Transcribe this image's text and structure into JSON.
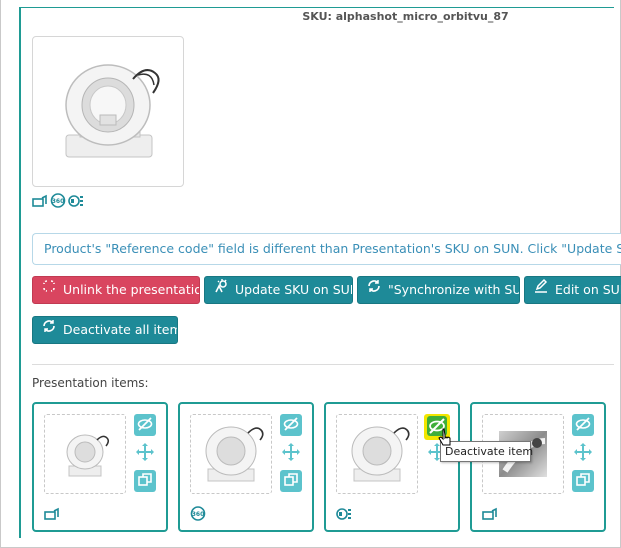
{
  "header": {
    "sku": "SKU: alphashot_micro_orbitvu_87"
  },
  "main_image": {
    "alt": "product-orbitvu-device"
  },
  "main_type_icons": [
    "photo-type-icon",
    "spin-360-icon",
    "video-type-icon"
  ],
  "notice": {
    "text": "Product's \"Reference code\" field is different than Presentation's SKU on SUN. Click \"Update SKU on SUN\""
  },
  "buttons": {
    "unlink": "Unlink the presentation",
    "update_sku": "Update SKU on SUN",
    "synchronize": "\"Synchronize with SUN",
    "edit": "Edit on SUN",
    "deactivate_all": "Deactivate all items"
  },
  "items": {
    "label": "Presentation items:",
    "list": [
      {
        "type_icon": "photo-type-icon"
      },
      {
        "type_icon": "spin-360-icon"
      },
      {
        "type_icon": "video-type-icon"
      },
      {
        "type_icon": "photo-type-icon"
      }
    ]
  },
  "tooltip": {
    "text": "Deactivate item"
  },
  "colors": {
    "accent": "#1f9b94",
    "danger": "#d9455f",
    "primary": "#1e8a98",
    "info": "#3a8fb7",
    "highlight": "#f2e600"
  }
}
